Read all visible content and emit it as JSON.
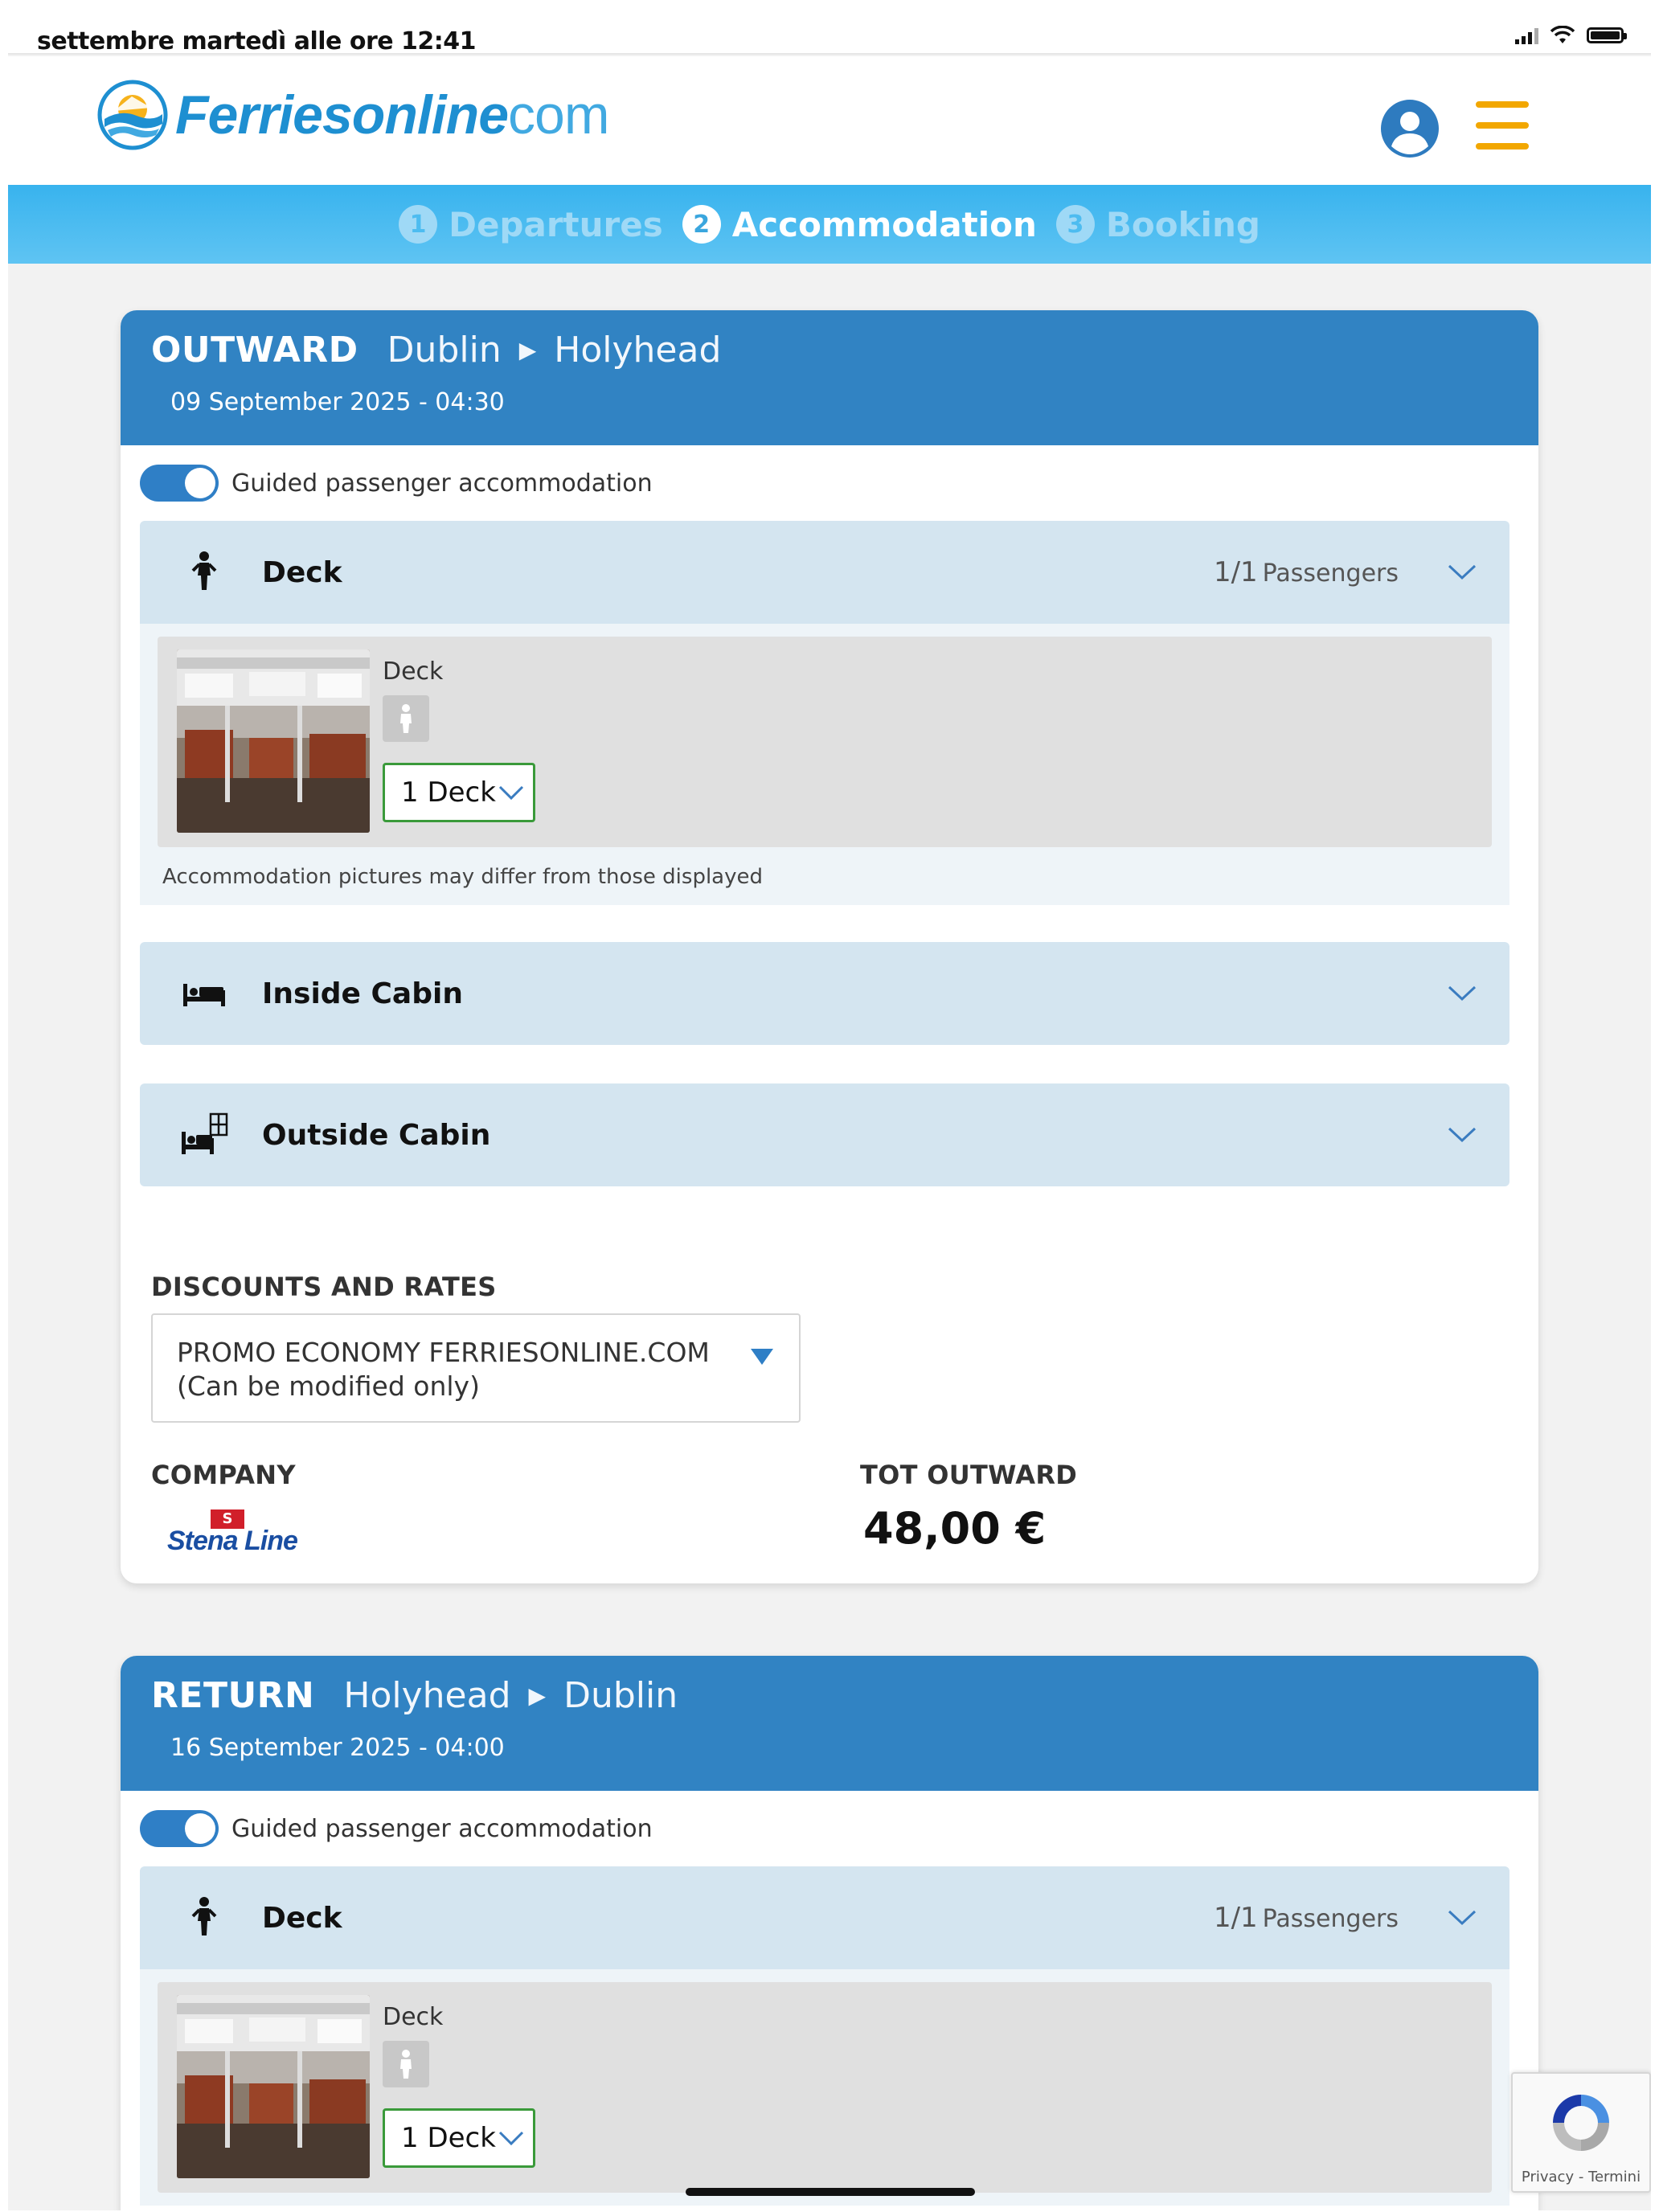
{
  "status_bar": {
    "time": "settembre martedì alle ore 12:41"
  },
  "header": {
    "brand_main": "Ferriesonline",
    "brand_suffix": "com"
  },
  "steps": [
    {
      "num": "1",
      "label": "Departures",
      "active": false
    },
    {
      "num": "2",
      "label": "Accommodation",
      "active": true
    },
    {
      "num": "3",
      "label": "Booking",
      "active": false
    }
  ],
  "outward": {
    "direction": "OUTWARD",
    "from": "Dublin",
    "to": "Holyhead",
    "date": "09 September 2025 - 04:30",
    "toggle_label": "Guided passenger accommodation",
    "deck": {
      "title": "Deck",
      "pax_count": "1/1",
      "pax_label": "Passengers",
      "option_name": "Deck",
      "select_value": "1 Deck",
      "note": "Accommodation pictures may differ from those displayed"
    },
    "inside_cabin": {
      "title": "Inside Cabin"
    },
    "outside_cabin": {
      "title": "Outside Cabin"
    },
    "discounts_label": "DISCOUNTS AND RATES",
    "rate_line1": "PROMO ECONOMY  FERRIESONLINE.COM",
    "rate_line2": "(Can be modified only)",
    "company_label": "COMPANY",
    "company_logo_text": "Stena Line",
    "total_label": "TOT OUTWARD",
    "total_value": "48,00 €"
  },
  "return": {
    "direction": "RETURN",
    "from": "Holyhead",
    "to": "Dublin",
    "date": "16 September 2025 - 04:00",
    "toggle_label": "Guided passenger accommodation",
    "deck": {
      "title": "Deck",
      "pax_count": "1/1",
      "pax_label": "Passengers",
      "option_name": "Deck",
      "select_value": "1 Deck"
    }
  },
  "recaptcha": {
    "text": "Privacy - Termini"
  },
  "colors": {
    "brand_blue": "#3183c3",
    "steps_blue": "#38b3ee",
    "menu_yellow": "#f2a700",
    "panel_blue": "#d4e5f0",
    "select_green": "#3a9a3a"
  },
  "icons": [
    "signal-icon",
    "wifi-icon",
    "battery-icon",
    "user-icon",
    "menu-icon",
    "person-icon",
    "bed-icon",
    "bed-window-icon",
    "chevron-down-icon",
    "dropdown-triangle-icon",
    "recaptcha-icon"
  ]
}
